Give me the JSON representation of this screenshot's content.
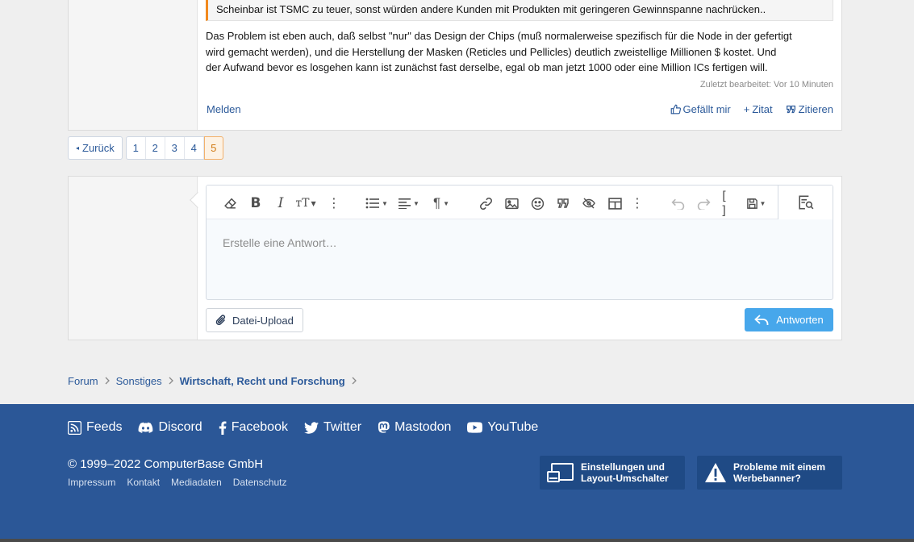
{
  "post": {
    "quote_text": "Scheinbar ist TSMC zu teuer, sonst würden andere Kunden mit Produkten mit geringeren Gewinnspanne nachrücken..",
    "body_lines": [
      "Das Problem ist eben auch, daß selbst \"nur\" das Design der Chips (muß normalerweise spezifisch für die Node in der gefertigt",
      "wird gemacht werden), und die Herstellung der Masken (Reticles und Pellicles) deutlich zweistellige Millionen $ kostet. Und",
      "der Aufwand bevor es losgehen kann ist zunächst fast derselbe, egal ob man jetzt 1000 oder eine Million ICs fertigen will."
    ],
    "edited": "Zuletzt bearbeitet: Vor 10 Minuten",
    "report": "Melden",
    "like": "Gefällt mir",
    "plus_quote": "Zitat",
    "quote_reply": "Zitieren"
  },
  "pager": {
    "back": "Zurück",
    "pages": [
      "1",
      "2",
      "3",
      "4",
      "5"
    ],
    "current": "5"
  },
  "editor": {
    "placeholder": "Erstelle eine Antwort…",
    "upload": "Datei-Upload",
    "submit": "Antworten",
    "tools": [
      "eraser-icon",
      "bold-icon",
      "italic-icon",
      "font-size-icon",
      "more-vertical-icon",
      "list-icon",
      "align-icon",
      "paragraph-icon",
      "link-icon",
      "image-icon",
      "smilie-icon",
      "quote-icon",
      "spoiler-icon",
      "table-icon",
      "more-vertical-icon",
      "undo-icon",
      "redo-icon",
      "bbcode-icon",
      "drafts-icon",
      "preview-icon"
    ]
  },
  "breadcrumb": [
    "Forum",
    "Sonstiges",
    "Wirtschaft, Recht und Forschung"
  ],
  "footer": {
    "social": [
      "Feeds",
      "Discord",
      "Facebook",
      "Twitter",
      "Mastodon",
      "YouTube"
    ],
    "copyright": "© 1999–2022 ComputerBase GmbH",
    "legal": [
      "Impressum",
      "Kontakt",
      "Mediadaten",
      "Datenschutz"
    ],
    "settings_line1": "Einstellungen und",
    "settings_line2": "Layout-Umschalter",
    "ad_line1": "Probleme mit einem",
    "ad_line2": "Werbebanner?"
  },
  "colors": {
    "accent": "#2c5a9a",
    "quote_border": "#f28a1e",
    "submit": "#47a7eb",
    "footer": "#2b5797"
  }
}
